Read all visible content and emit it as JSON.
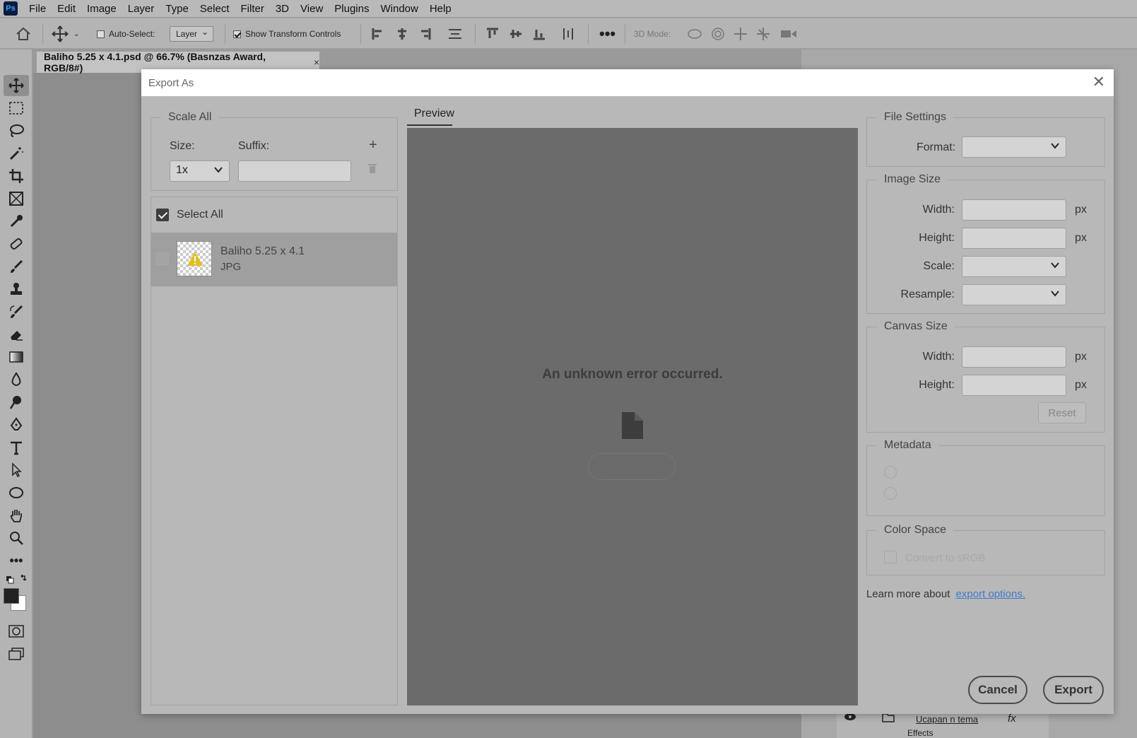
{
  "menu": [
    "File",
    "Edit",
    "Image",
    "Layer",
    "Type",
    "Select",
    "Filter",
    "3D",
    "View",
    "Plugins",
    "Window",
    "Help"
  ],
  "options": {
    "auto_select_label": "Auto-Select:",
    "auto_select_value": "Layer",
    "show_transform_label": "Show Transform Controls",
    "mode_3d_label": "3D Mode:"
  },
  "document": {
    "tab_title": "Baliho 5.25 x 4.1.psd @ 66.7% (Basnzas Award, RGB/8#)",
    "tab_close": "×"
  },
  "layers": {
    "group_name": "Ucapan n tema",
    "effects_label": "Effects",
    "fx_label": "fx"
  },
  "dialog": {
    "title": "Export As",
    "scale_all": {
      "legend": "Scale All",
      "size_label": "Size:",
      "suffix_label": "Suffix:",
      "size_value": "1x",
      "suffix_value": ""
    },
    "select_all_label": "Select All",
    "asset": {
      "name": "Baliho 5.25 x 4.1",
      "format": "JPG"
    },
    "preview_tab": "Preview",
    "error_message": "An unknown error occurred.",
    "file_settings": {
      "legend": "File Settings",
      "format_label": "Format:"
    },
    "image_size": {
      "legend": "Image Size",
      "width_label": "Width:",
      "height_label": "Height:",
      "scale_label": "Scale:",
      "resample_label": "Resample:",
      "unit": "px"
    },
    "canvas_size": {
      "legend": "Canvas Size",
      "width_label": "Width:",
      "height_label": "Height:",
      "unit": "px",
      "reset_label": "Reset"
    },
    "metadata": {
      "legend": "Metadata"
    },
    "color_space": {
      "legend": "Color Space",
      "convert_label": "Convert to sRGB"
    },
    "learn_more_text": "Learn more about",
    "learn_more_link": "export options.",
    "cancel_label": "Cancel",
    "export_label": "Export"
  }
}
